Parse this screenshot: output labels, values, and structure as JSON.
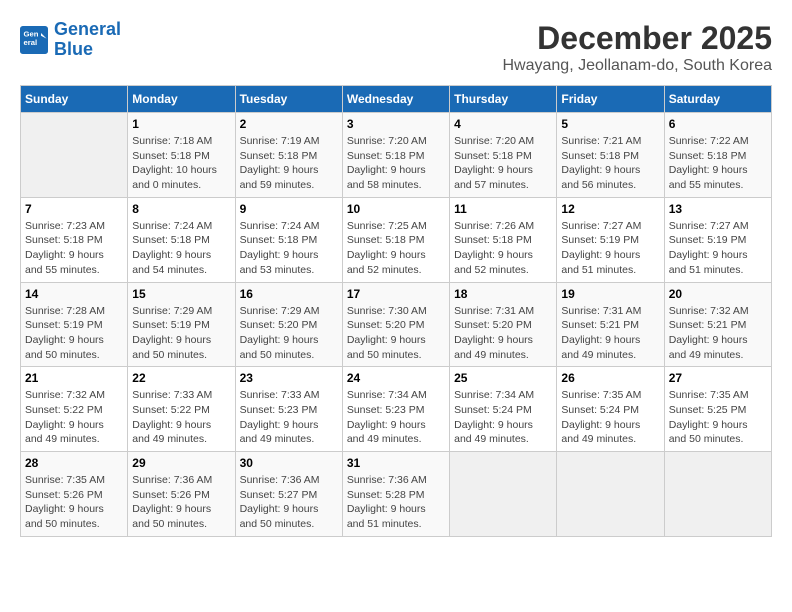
{
  "logo": {
    "line1": "General",
    "line2": "Blue"
  },
  "title": "December 2025",
  "subtitle": "Hwayang, Jeollanam-do, South Korea",
  "days_header": [
    "Sunday",
    "Monday",
    "Tuesday",
    "Wednesday",
    "Thursday",
    "Friday",
    "Saturday"
  ],
  "weeks": [
    [
      {
        "day": "",
        "info": ""
      },
      {
        "day": "1",
        "info": "Sunrise: 7:18 AM\nSunset: 5:18 PM\nDaylight: 10 hours\nand 0 minutes."
      },
      {
        "day": "2",
        "info": "Sunrise: 7:19 AM\nSunset: 5:18 PM\nDaylight: 9 hours\nand 59 minutes."
      },
      {
        "day": "3",
        "info": "Sunrise: 7:20 AM\nSunset: 5:18 PM\nDaylight: 9 hours\nand 58 minutes."
      },
      {
        "day": "4",
        "info": "Sunrise: 7:20 AM\nSunset: 5:18 PM\nDaylight: 9 hours\nand 57 minutes."
      },
      {
        "day": "5",
        "info": "Sunrise: 7:21 AM\nSunset: 5:18 PM\nDaylight: 9 hours\nand 56 minutes."
      },
      {
        "day": "6",
        "info": "Sunrise: 7:22 AM\nSunset: 5:18 PM\nDaylight: 9 hours\nand 55 minutes."
      }
    ],
    [
      {
        "day": "7",
        "info": "Sunrise: 7:23 AM\nSunset: 5:18 PM\nDaylight: 9 hours\nand 55 minutes."
      },
      {
        "day": "8",
        "info": "Sunrise: 7:24 AM\nSunset: 5:18 PM\nDaylight: 9 hours\nand 54 minutes."
      },
      {
        "day": "9",
        "info": "Sunrise: 7:24 AM\nSunset: 5:18 PM\nDaylight: 9 hours\nand 53 minutes."
      },
      {
        "day": "10",
        "info": "Sunrise: 7:25 AM\nSunset: 5:18 PM\nDaylight: 9 hours\nand 52 minutes."
      },
      {
        "day": "11",
        "info": "Sunrise: 7:26 AM\nSunset: 5:18 PM\nDaylight: 9 hours\nand 52 minutes."
      },
      {
        "day": "12",
        "info": "Sunrise: 7:27 AM\nSunset: 5:19 PM\nDaylight: 9 hours\nand 51 minutes."
      },
      {
        "day": "13",
        "info": "Sunrise: 7:27 AM\nSunset: 5:19 PM\nDaylight: 9 hours\nand 51 minutes."
      }
    ],
    [
      {
        "day": "14",
        "info": "Sunrise: 7:28 AM\nSunset: 5:19 PM\nDaylight: 9 hours\nand 50 minutes."
      },
      {
        "day": "15",
        "info": "Sunrise: 7:29 AM\nSunset: 5:19 PM\nDaylight: 9 hours\nand 50 minutes."
      },
      {
        "day": "16",
        "info": "Sunrise: 7:29 AM\nSunset: 5:20 PM\nDaylight: 9 hours\nand 50 minutes."
      },
      {
        "day": "17",
        "info": "Sunrise: 7:30 AM\nSunset: 5:20 PM\nDaylight: 9 hours\nand 50 minutes."
      },
      {
        "day": "18",
        "info": "Sunrise: 7:31 AM\nSunset: 5:20 PM\nDaylight: 9 hours\nand 49 minutes."
      },
      {
        "day": "19",
        "info": "Sunrise: 7:31 AM\nSunset: 5:21 PM\nDaylight: 9 hours\nand 49 minutes."
      },
      {
        "day": "20",
        "info": "Sunrise: 7:32 AM\nSunset: 5:21 PM\nDaylight: 9 hours\nand 49 minutes."
      }
    ],
    [
      {
        "day": "21",
        "info": "Sunrise: 7:32 AM\nSunset: 5:22 PM\nDaylight: 9 hours\nand 49 minutes."
      },
      {
        "day": "22",
        "info": "Sunrise: 7:33 AM\nSunset: 5:22 PM\nDaylight: 9 hours\nand 49 minutes."
      },
      {
        "day": "23",
        "info": "Sunrise: 7:33 AM\nSunset: 5:23 PM\nDaylight: 9 hours\nand 49 minutes."
      },
      {
        "day": "24",
        "info": "Sunrise: 7:34 AM\nSunset: 5:23 PM\nDaylight: 9 hours\nand 49 minutes."
      },
      {
        "day": "25",
        "info": "Sunrise: 7:34 AM\nSunset: 5:24 PM\nDaylight: 9 hours\nand 49 minutes."
      },
      {
        "day": "26",
        "info": "Sunrise: 7:35 AM\nSunset: 5:24 PM\nDaylight: 9 hours\nand 49 minutes."
      },
      {
        "day": "27",
        "info": "Sunrise: 7:35 AM\nSunset: 5:25 PM\nDaylight: 9 hours\nand 50 minutes."
      }
    ],
    [
      {
        "day": "28",
        "info": "Sunrise: 7:35 AM\nSunset: 5:26 PM\nDaylight: 9 hours\nand 50 minutes."
      },
      {
        "day": "29",
        "info": "Sunrise: 7:36 AM\nSunset: 5:26 PM\nDaylight: 9 hours\nand 50 minutes."
      },
      {
        "day": "30",
        "info": "Sunrise: 7:36 AM\nSunset: 5:27 PM\nDaylight: 9 hours\nand 50 minutes."
      },
      {
        "day": "31",
        "info": "Sunrise: 7:36 AM\nSunset: 5:28 PM\nDaylight: 9 hours\nand 51 minutes."
      },
      {
        "day": "",
        "info": ""
      },
      {
        "day": "",
        "info": ""
      },
      {
        "day": "",
        "info": ""
      }
    ]
  ]
}
